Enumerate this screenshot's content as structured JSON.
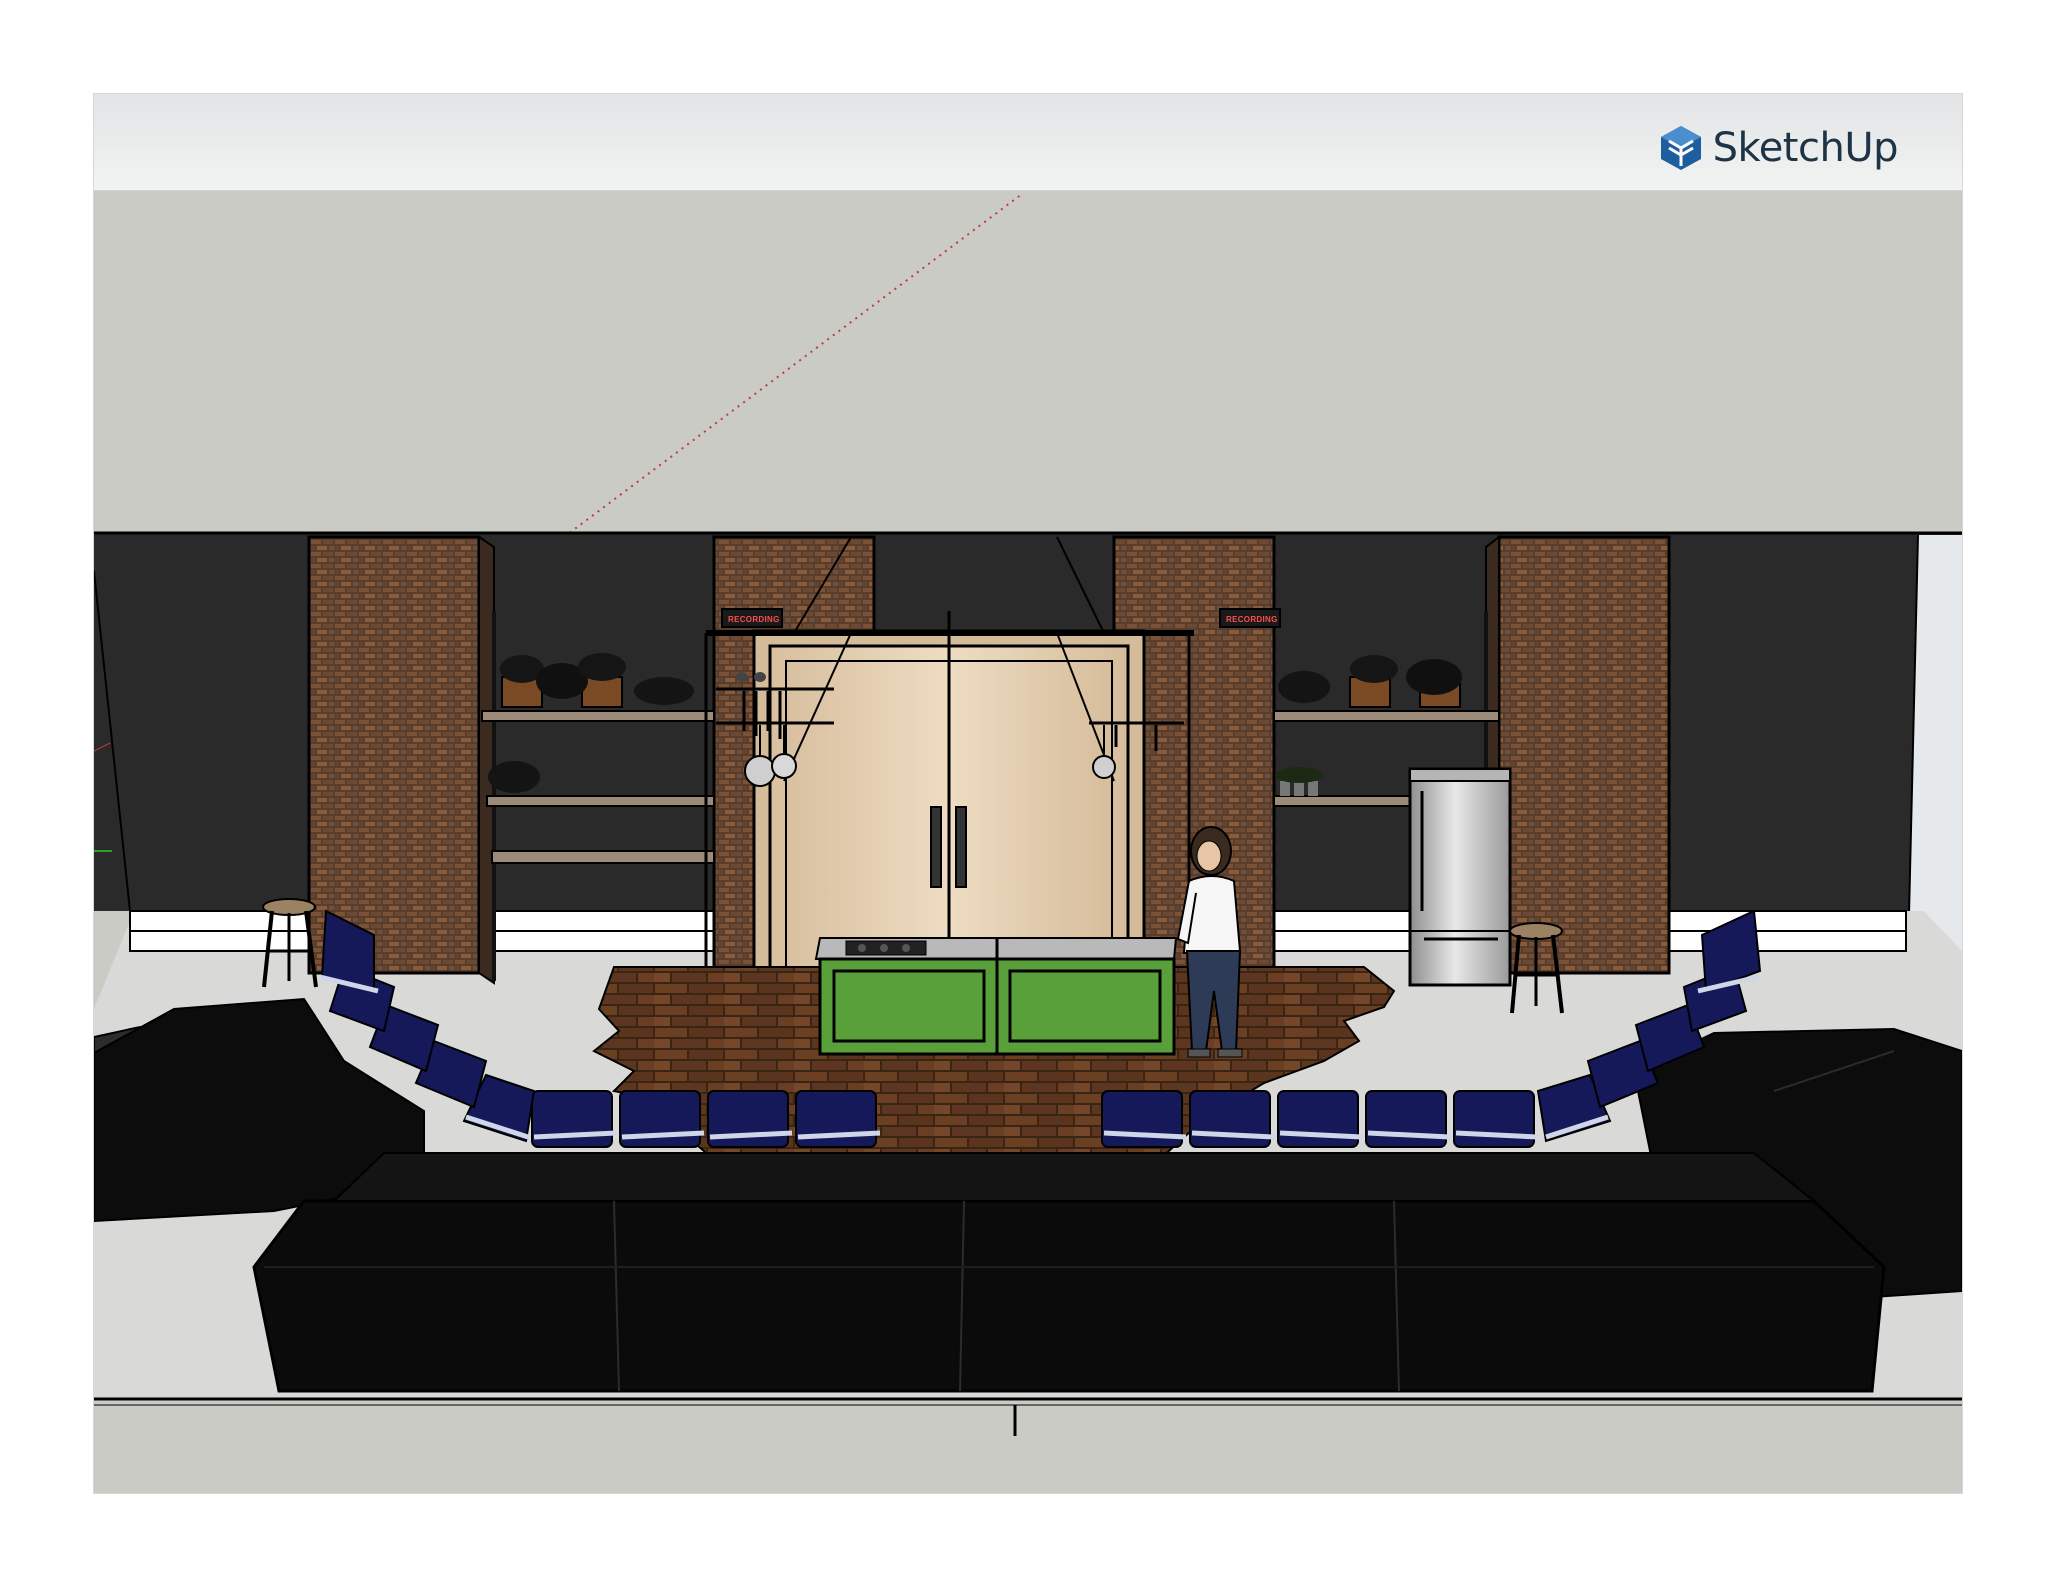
{
  "app": {
    "name": "SketchUp",
    "brand_color": "#1d5f9e",
    "logo_icon": "sketchup-logo-icon"
  },
  "scene": {
    "signs": [
      "RECORDING",
      "RECORDING"
    ],
    "colors": {
      "sky": "#cbcbc6",
      "back_wall": "#2a2a2a",
      "floor": "#d9d9d7",
      "brick": "#6a4a34",
      "island": "#5aa03a",
      "door": "#dfc9aa",
      "chair": "#15195a",
      "sofa": "#0c0c0c",
      "wood_floor": "#5a341c"
    }
  }
}
